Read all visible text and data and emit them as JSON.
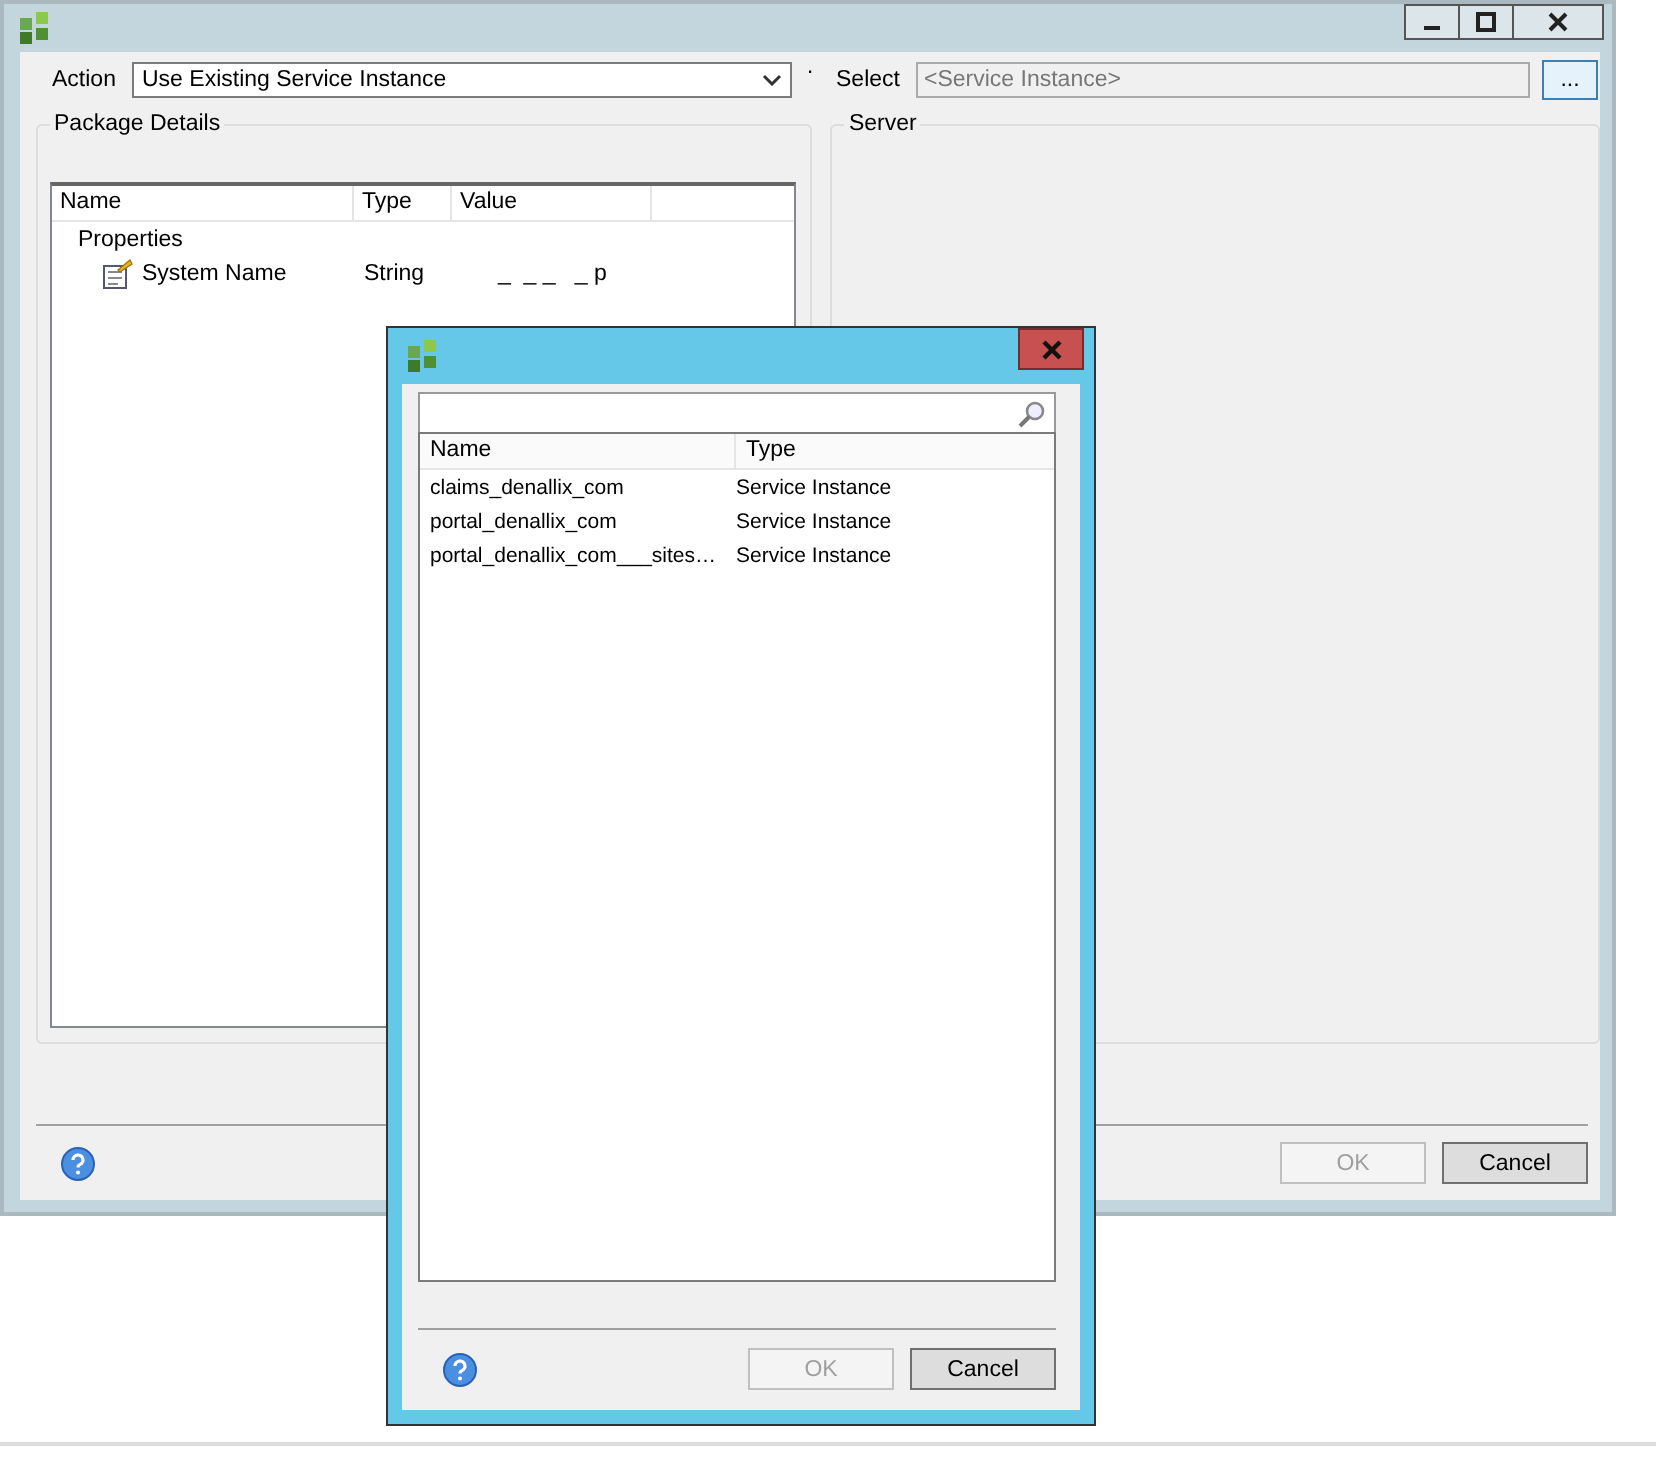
{
  "main_window": {
    "action": {
      "label": "Action",
      "value": "Use Existing Service Instance"
    },
    "marker": "·",
    "select": {
      "label": "Select",
      "placeholder": "<Service Instance>",
      "browse": "..."
    },
    "package_details": {
      "title": "Package Details",
      "columns": [
        "Name",
        "Type",
        "Value"
      ],
      "tree": [
        {
          "label": "Properties",
          "children": [
            {
              "name": "System Name",
              "type": "String",
              "value": "_  _ _   _ p"
            }
          ]
        }
      ]
    },
    "server": {
      "title": "Server"
    },
    "buttons": [
      {
        "label": "OK",
        "disabled": true
      },
      {
        "label": "Cancel",
        "disabled": false
      }
    ]
  },
  "dialog": {
    "columns": [
      "Name",
      "Type"
    ],
    "rows": [
      {
        "name": "claims_denallix_com",
        "type": "Service Instance"
      },
      {
        "name": "portal_denallix_com",
        "type": "Service Instance"
      },
      {
        "name": "portal_denallix_com___sites…",
        "type": "Service Instance"
      }
    ],
    "buttons": [
      {
        "label": "OK",
        "disabled": true
      },
      {
        "label": "Cancel",
        "disabled": false
      }
    ]
  }
}
